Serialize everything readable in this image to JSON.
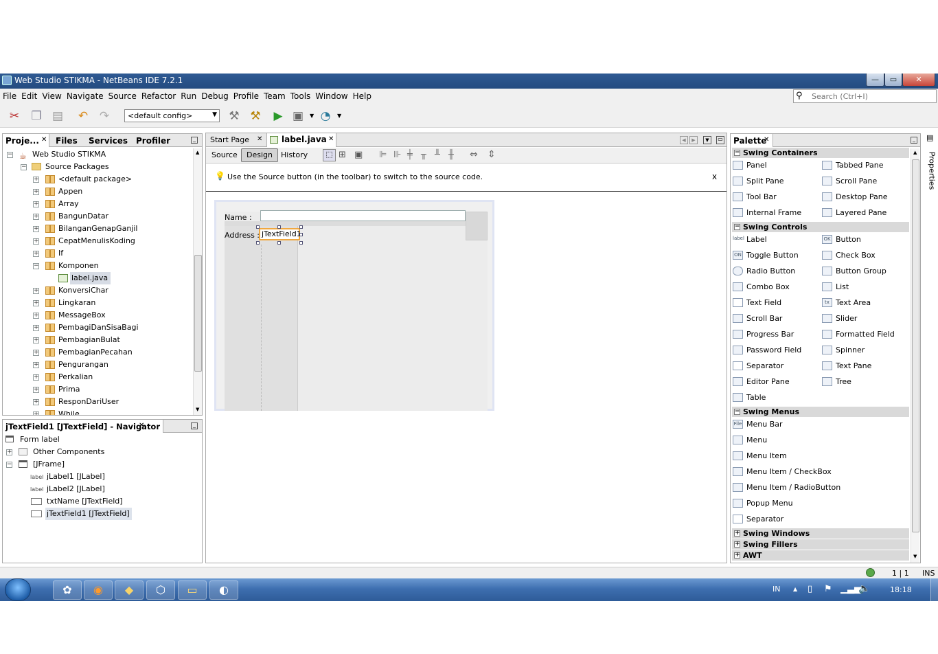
{
  "window": {
    "title": "Web Studio STIKMA - NetBeans IDE 7.2.1",
    "min": "—",
    "max": "▭",
    "close": "✕"
  },
  "menu": [
    "File",
    "Edit",
    "View",
    "Navigate",
    "Source",
    "Refactor",
    "Run",
    "Debug",
    "Profile",
    "Team",
    "Tools",
    "Window",
    "Help"
  ],
  "search": {
    "placeholder": "Search (Ctrl+I)"
  },
  "toolbar": {
    "config": "<default config>"
  },
  "left_tabs": {
    "projects": "Proje...",
    "files": "Files",
    "services": "Services",
    "profiler": "Profiler"
  },
  "project_tree": {
    "root": "Web Studio STIKMA",
    "source_packages": "Source Packages",
    "packages": [
      "<default package>",
      "Appen",
      "Array",
      "BangunDatar",
      "BilanganGenapGanjil",
      "CepatMenulisKoding",
      "If",
      "Komponen"
    ],
    "file": "label.java",
    "packages2": [
      "KonversiChar",
      "Lingkaran",
      "MessageBox",
      "PembagiDanSisaBagi",
      "PembagianBulat",
      "PembagianPecahan",
      "Pengurangan",
      "Perkalian",
      "Prima",
      "ResponDariUser",
      "While"
    ]
  },
  "navigator": {
    "title": "jTextField1 [JTextField] - Navigator",
    "form": "Form label",
    "other": "Other Components",
    "frame": "[JFrame]",
    "items": [
      "jLabel1 [JLabel]",
      "jLabel2 [JLabel]",
      "txtName [JTextField]",
      "jTextField1 [JTextField]"
    ],
    "label_icon": "label"
  },
  "editor_tabs": {
    "start": "Start Page",
    "file": "label.java"
  },
  "editor_modes": {
    "source": "Source",
    "design": "Design",
    "history": "History"
  },
  "hint": "Use the Source button (in the toolbar) to switch to the source code.",
  "hint_close": "x",
  "form": {
    "name_label": "Name :",
    "address_label": "Address :",
    "field_text": "jTextField1"
  },
  "palette": {
    "title": "Palette",
    "sections": {
      "containers": "Swing Containers",
      "controls": "Swing Controls",
      "menus": "Swing Menus",
      "windows": "Swing Windows",
      "fillers": "Swing Fillers",
      "awt": "AWT"
    },
    "containers": [
      "Panel",
      "Tabbed Pane",
      "Split Pane",
      "Scroll Pane",
      "Tool Bar",
      "Desktop Pane",
      "Internal Frame",
      "Layered Pane"
    ],
    "controls": [
      "Label",
      "Button",
      "Toggle Button",
      "Check Box",
      "Radio Button",
      "Button Group",
      "Combo Box",
      "List",
      "Text Field",
      "Text Area",
      "Scroll Bar",
      "Slider",
      "Progress Bar",
      "Formatted Field",
      "Password Field",
      "Spinner",
      "Separator",
      "Text Pane",
      "Editor Pane",
      "Tree",
      "Table"
    ],
    "menus": [
      "Menu Bar",
      "Menu",
      "Menu Item",
      "Menu Item / CheckBox",
      "Menu Item / RadioButton",
      "Popup Menu",
      "Separator"
    ],
    "control_icons": {
      "label": "label",
      "button": "OK",
      "toggle": "ON",
      "textarea": "tx"
    },
    "menubar_icon": "File"
  },
  "properties_tab": "Properties",
  "status": {
    "position": "1 | 1",
    "mode": "INS"
  },
  "taskbar": {
    "lang": "IN",
    "time": "18:18"
  }
}
